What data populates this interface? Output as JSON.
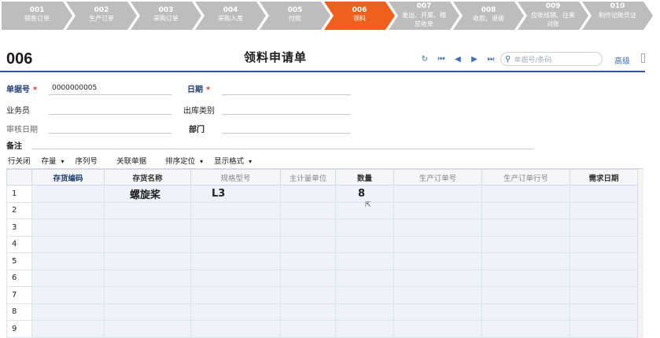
{
  "steps": [
    {
      "num": "001",
      "label": "销售订单",
      "active": false
    },
    {
      "num": "002",
      "label": "生产订单",
      "active": false
    },
    {
      "num": "003",
      "label": "采购订单",
      "active": false
    },
    {
      "num": "004",
      "label": "采购入库",
      "active": false
    },
    {
      "num": "005",
      "label": "付款",
      "active": false
    },
    {
      "num": "006",
      "label": "领料",
      "active": true
    },
    {
      "num": "007",
      "label": "发出、开票、稽应收单",
      "active": false
    },
    {
      "num": "008",
      "label": "收款、退拨",
      "active": false
    },
    {
      "num": "009",
      "label": "应收核销、往来对账",
      "active": false
    },
    {
      "num": "010",
      "label": "制作记账凭证",
      "active": false
    }
  ],
  "header": {
    "doc_no": "006",
    "title": "领料申请单",
    "search_placeholder": "单据号/条码",
    "advanced": "高级"
  },
  "form": {
    "doc_number_label": "单据号",
    "doc_number_value": "0000000005",
    "date_label": "日期",
    "clerk_label": "业务员",
    "out_type_label": "出库类别",
    "audit_date_label": "审核日期",
    "dept_label": "部门",
    "remark_label": "备注"
  },
  "toolbar": {
    "close_row": "行关闭",
    "stock": "存量",
    "serial": "序列号",
    "linked": "关联单据",
    "sort": "排序定位",
    "display": "显示格式"
  },
  "table": {
    "columns": [
      "",
      "存货编码",
      "存货名称",
      "规格型号",
      "主计量单位",
      "数量",
      "生产订单号",
      "生产订单行号",
      "需求日期"
    ],
    "rows": [
      [
        "1",
        "",
        "螺旋桨",
        "L3",
        "",
        "8",
        "",
        "",
        ""
      ],
      [
        "2",
        "",
        "",
        "",
        "",
        "",
        "",
        "",
        ""
      ],
      [
        "3",
        "",
        "",
        "",
        "",
        "",
        "",
        "",
        ""
      ],
      [
        "4",
        "",
        "",
        "",
        "",
        "",
        "",
        "",
        ""
      ],
      [
        "5",
        "",
        "",
        "",
        "",
        "",
        "",
        "",
        ""
      ],
      [
        "6",
        "",
        "",
        "",
        "",
        "",
        "",
        "",
        ""
      ],
      [
        "7",
        "",
        "",
        "",
        "",
        "",
        "",
        "",
        ""
      ],
      [
        "8",
        "",
        "",
        "",
        "",
        "",
        "",
        "",
        ""
      ],
      [
        "9",
        "",
        "",
        "",
        "",
        "",
        "",
        "",
        ""
      ]
    ]
  },
  "colors": {
    "active_step": "#f0601d",
    "step": "#bdbdbd",
    "accent": "#2b5b9c"
  }
}
